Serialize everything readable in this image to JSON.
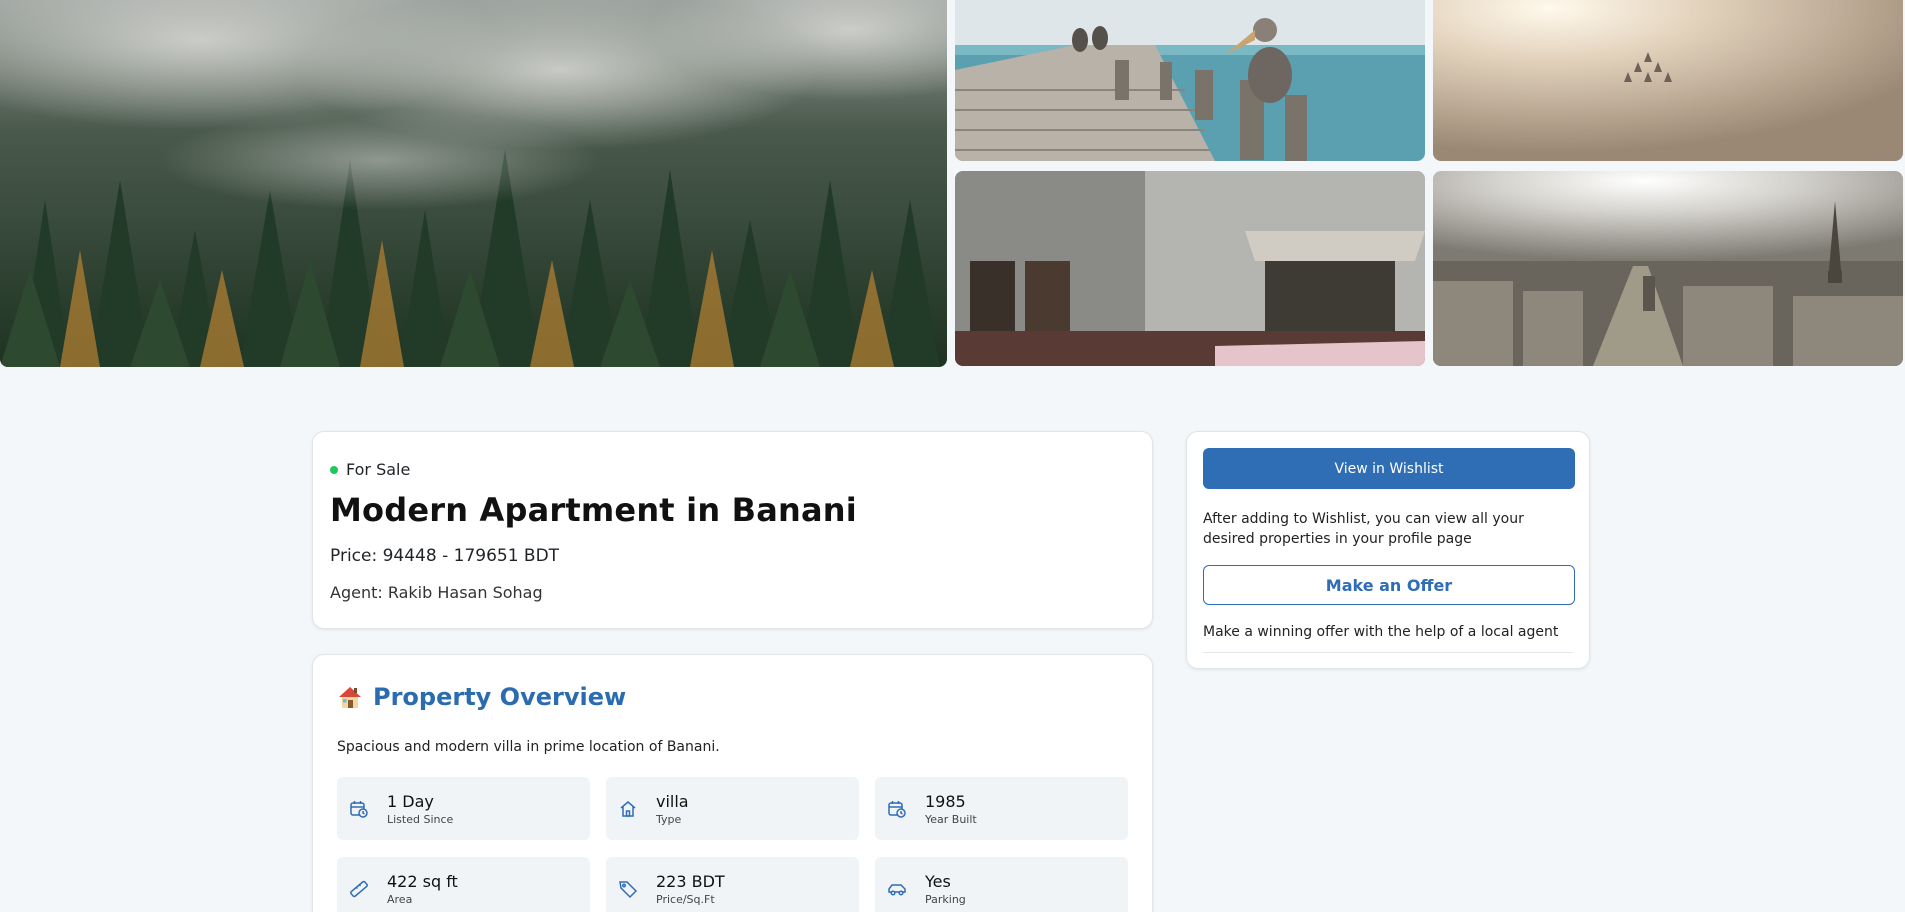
{
  "gallery": {
    "images": [
      {
        "name": "misty-forest"
      },
      {
        "name": "pelicans-on-pier"
      },
      {
        "name": "jets-in-hazy-sky"
      },
      {
        "name": "old-building"
      },
      {
        "name": "paris-skyline"
      }
    ]
  },
  "listing": {
    "status": "For Sale",
    "status_color": "#22c55e",
    "title": "Modern Apartment in Banani",
    "price": "Price: 94448 - 179651 BDT",
    "agent": "Agent: Rakib Hasan Sohag"
  },
  "overview": {
    "icon": "house-emoji",
    "title": "Property Overview",
    "description": "Spacious and modern villa in prime location of Banani.",
    "stats": [
      {
        "icon": "calendar-clock-icon",
        "value": "1 Day",
        "label": "Listed Since"
      },
      {
        "icon": "home-icon",
        "value": "villa",
        "label": "Type"
      },
      {
        "icon": "calendar-clock-icon",
        "value": "1985",
        "label": "Year Built"
      },
      {
        "icon": "ruler-icon",
        "value": "422 sq ft",
        "label": "Area"
      },
      {
        "icon": "tag-icon",
        "value": "223 BDT",
        "label": "Price/Sq.Ft"
      },
      {
        "icon": "car-icon",
        "value": "Yes",
        "label": "Parking"
      }
    ]
  },
  "sidebar": {
    "wishlist_button": "View in Wishlist",
    "wishlist_note": "After adding to Wishlist, you can view all your desired properties in your profile page",
    "offer_button": "Make an Offer",
    "offer_note": "Make a winning offer with the help of a local agent"
  },
  "colors": {
    "accent": "#2f6db5",
    "heading_blue": "#2b6cb0",
    "page_bg": "#f4f7fa"
  }
}
